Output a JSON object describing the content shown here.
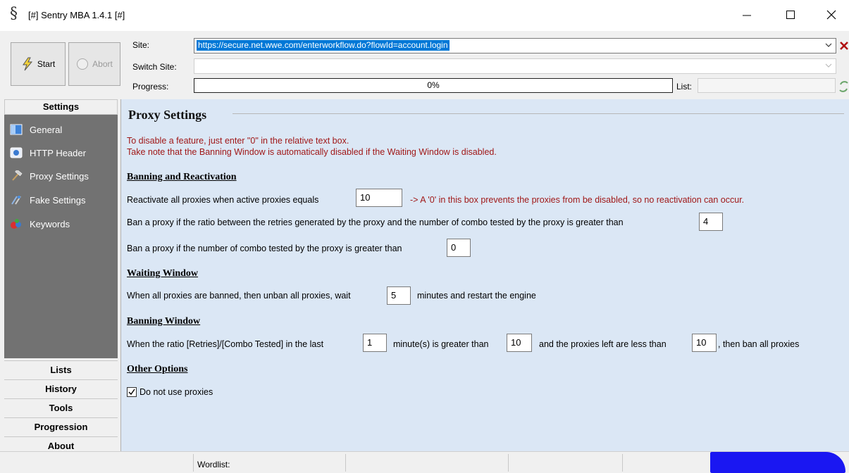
{
  "window": {
    "title": "[#] Sentry MBA 1.4.1 [#]",
    "icon": "dollar-s-icon"
  },
  "toolbar": {
    "start_label": "Start",
    "abort_label": "Abort",
    "site_label": "Site:",
    "site_value": "https://secure.net.wwe.com/enterworkflow.do?flowId=account.login",
    "switch_site_label": "Switch Site:",
    "switch_site_value": "",
    "progress_label": "Progress:",
    "progress_value": "0%",
    "list_label": "List:",
    "list_value": ""
  },
  "sidebar": {
    "settings_header": "Settings",
    "items": [
      {
        "label": "General",
        "icon": "general-icon"
      },
      {
        "label": "HTTP Header",
        "icon": "http-header-icon"
      },
      {
        "label": "Proxy Settings",
        "icon": "hammer-icon"
      },
      {
        "label": "Fake Settings",
        "icon": "fake-settings-icon"
      },
      {
        "label": "Keywords",
        "icon": "keywords-icon"
      }
    ],
    "bottom": [
      "Lists",
      "History",
      "Tools",
      "Progression",
      "About"
    ]
  },
  "main": {
    "title": "Proxy Settings",
    "warn_line1": "To disable a feature, just enter \"0\" in the relative text box.",
    "warn_line2": "Take note that the Banning Window is automatically disabled if the Waiting Window is disabled.",
    "banning": {
      "heading": "Banning and Reactivation",
      "reactivate_text": "Reactivate all proxies when active proxies equals",
      "reactivate_value": "10",
      "reactivate_note": "-> A '0' in this box prevents the proxies from be disabled, so no reactivation can occur.",
      "ratio_text": "Ban a proxy if the ratio between the retries generated by the proxy and the number of combo tested by the proxy is greater than",
      "ratio_value": "4",
      "combo_text": "Ban a proxy if the number of combo tested by the proxy is greater than",
      "combo_value": "0"
    },
    "waiting": {
      "heading": "Waiting Window",
      "text_before": "When all proxies are banned, then unban all proxies, wait",
      "value": "5",
      "text_after": "minutes and restart the engine"
    },
    "banning_window": {
      "heading": "Banning Window",
      "text1": "When the ratio [Retries]/[Combo Tested] in the last",
      "value1": "1",
      "text2": "minute(s) is greater than",
      "value2": "10",
      "text3": "and the proxies left are less than",
      "value3": "10",
      "text4": ", then ban all proxies"
    },
    "other": {
      "heading": "Other Options",
      "no_proxies_label": "Do not use proxies",
      "no_proxies_checked": true
    }
  },
  "statusbar": {
    "wordlist_label": "Wordlist:"
  },
  "colors": {
    "main_bg": "#dbe7f5",
    "sidebar_bg": "#727272",
    "warn_text": "#a01818",
    "selection": "#0078d7"
  }
}
